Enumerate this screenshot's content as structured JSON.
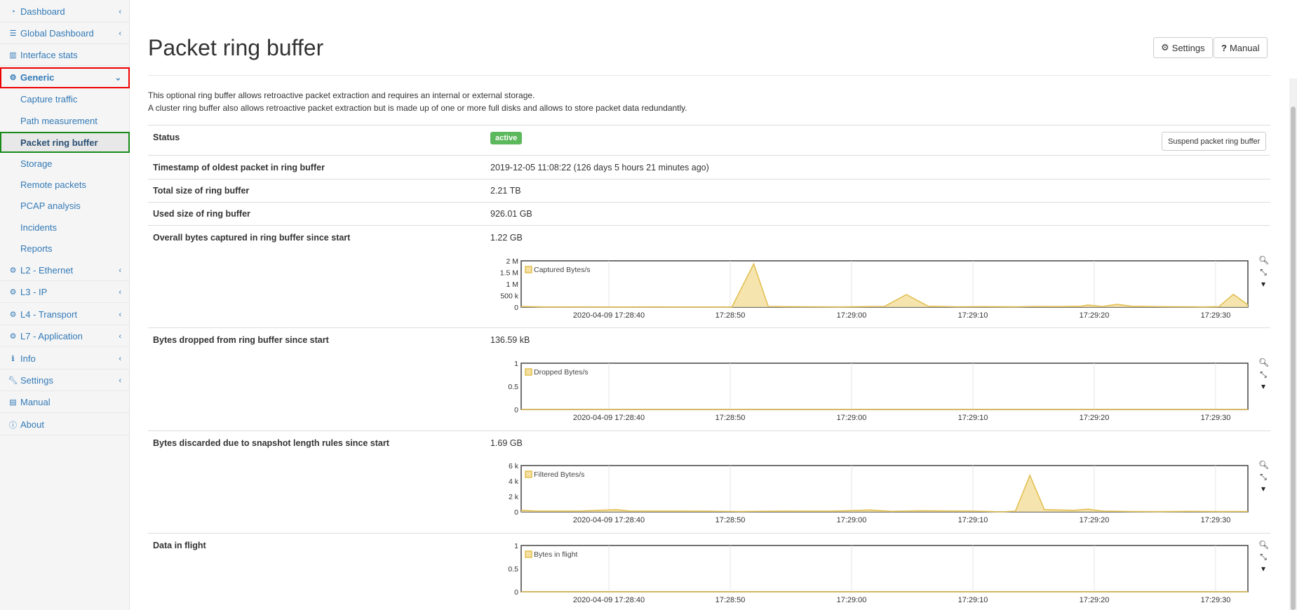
{
  "sidebar": {
    "items": [
      {
        "label": "Dashboard",
        "icon": "dashboard-icon"
      },
      {
        "label": "Global Dashboard",
        "icon": "list-icon"
      },
      {
        "label": "Interface stats",
        "icon": "bar-chart-icon"
      },
      {
        "label": "Generic",
        "icon": "gear-icon"
      },
      {
        "label": "L2 - Ethernet",
        "icon": "gear-icon"
      },
      {
        "label": "L3 - IP",
        "icon": "gear-icon"
      },
      {
        "label": "L4 - Transport",
        "icon": "gear-icon"
      },
      {
        "label": "L7 - Application",
        "icon": "gear-icon"
      },
      {
        "label": "Info",
        "icon": "info-icon"
      },
      {
        "label": "Settings",
        "icon": "wrench-icon"
      },
      {
        "label": "Manual",
        "icon": "book-icon"
      },
      {
        "label": "About",
        "icon": "info-circle-icon"
      }
    ],
    "generic_subitems": [
      "Capture traffic",
      "Path measurement",
      "Packet ring buffer",
      "Storage",
      "Remote packets",
      "PCAP analysis",
      "Incidents",
      "Reports"
    ]
  },
  "header": {
    "title": "Packet ring buffer",
    "settings_label": "Settings",
    "manual_label": "Manual"
  },
  "description": {
    "line1": "This optional ring buffer allows retroactive packet extraction and requires an internal or external storage.",
    "line2": "A cluster ring buffer also allows retroactive packet extraction but is made up of one or more full disks and allows to store packet data redundantly."
  },
  "table": {
    "status_label": "Status",
    "status_value": "active",
    "suspend_label": "Suspend packet ring buffer",
    "oldest_label": "Timestamp of oldest packet in ring buffer",
    "oldest_value": "2019-12-05 11:08:22 (126 days 5 hours 21 minutes ago)",
    "total_label": "Total size of ring buffer",
    "total_value": "2.21 TB",
    "used_label": "Used size of ring buffer",
    "used_value": "926.01 GB",
    "captured_label": "Overall bytes captured in ring buffer since start",
    "captured_value": "1.22 GB",
    "dropped_label": "Bytes dropped from ring buffer since start",
    "dropped_value": "136.59 kB",
    "discarded_label": "Bytes discarded due to snapshot length rules since start",
    "discarded_value": "1.69 GB",
    "inflight_label": "Data in flight"
  },
  "colors": {
    "link": "#337ab7",
    "badge_active": "#5cb85c",
    "series_line": "#e2c053",
    "series_fill": "#f5dfa1",
    "generic_highlight": "#ee0000",
    "current_highlight": "#1a8a1a"
  },
  "chart_data": [
    {
      "type": "area",
      "series": [
        {
          "name": "Captured Bytes/s",
          "values": [
            [
              0,
              30000
            ],
            [
              3,
              10000
            ],
            [
              8,
              8000
            ],
            [
              13,
              5000
            ],
            [
              18,
              9000
            ],
            [
              22,
              6000
            ],
            [
              26,
              3000
            ],
            [
              29,
              2000
            ],
            [
              32,
              1900000
            ],
            [
              34,
              30000
            ],
            [
              36,
              20000
            ],
            [
              40,
              15000
            ],
            [
              44,
              10000
            ],
            [
              48,
              25000
            ],
            [
              50,
              30000
            ],
            [
              53,
              550000
            ],
            [
              56,
              40000
            ],
            [
              60,
              15000
            ],
            [
              64,
              20000
            ],
            [
              68,
              12000
            ],
            [
              71,
              30000
            ],
            [
              74,
              25000
            ],
            [
              77,
              40000
            ],
            [
              78,
              90000
            ],
            [
              80,
              30000
            ],
            [
              82,
              120000
            ],
            [
              84,
              40000
            ],
            [
              88,
              20000
            ],
            [
              92,
              15000
            ],
            [
              94,
              10000
            ],
            [
              96,
              20000
            ],
            [
              98,
              560000
            ],
            [
              100,
              100000
            ]
          ]
        }
      ],
      "x_ticks": [
        "2020-04-09 17:28:40",
        "17:28:50",
        "17:29:00",
        "17:29:10",
        "17:29:20",
        "17:29:30"
      ],
      "y_ticks": [
        "2 M",
        "1.5 M",
        "1 M",
        "500 k",
        "0"
      ],
      "ylim": [
        0,
        2000000
      ]
    },
    {
      "type": "area",
      "series": [
        {
          "name": "Dropped Bytes/s",
          "values": [
            [
              0,
              0
            ],
            [
              100,
              0
            ]
          ]
        }
      ],
      "x_ticks": [
        "2020-04-09 17:28:40",
        "17:28:50",
        "17:29:00",
        "17:29:10",
        "17:29:20",
        "17:29:30"
      ],
      "y_ticks": [
        "1",
        "0.5",
        "0"
      ],
      "ylim": [
        0,
        1
      ]
    },
    {
      "type": "area",
      "series": [
        {
          "name": "Filtered Bytes/s",
          "values": [
            [
              0,
              200
            ],
            [
              2,
              100
            ],
            [
              8,
              100
            ],
            [
              13,
              300
            ],
            [
              15,
              100
            ],
            [
              22,
              100
            ],
            [
              26,
              80
            ],
            [
              30,
              50
            ],
            [
              36,
              100
            ],
            [
              42,
              80
            ],
            [
              45,
              150
            ],
            [
              48,
              250
            ],
            [
              51,
              60
            ],
            [
              55,
              150
            ],
            [
              58,
              120
            ],
            [
              62,
              100
            ],
            [
              64,
              60
            ],
            [
              66,
              0
            ],
            [
              68,
              90
            ],
            [
              70,
              4800
            ],
            [
              72,
              300
            ],
            [
              74,
              250
            ],
            [
              76,
              200
            ],
            [
              78,
              350
            ],
            [
              80,
              100
            ],
            [
              84,
              50
            ],
            [
              88,
              30
            ],
            [
              92,
              60
            ],
            [
              96,
              40
            ],
            [
              100,
              50
            ]
          ]
        }
      ],
      "x_ticks": [
        "2020-04-09 17:28:40",
        "17:28:50",
        "17:29:00",
        "17:29:10",
        "17:29:20",
        "17:29:30"
      ],
      "y_ticks": [
        "6 k",
        "4 k",
        "2 k",
        "0"
      ],
      "ylim": [
        0,
        6000
      ]
    },
    {
      "type": "area",
      "series": [
        {
          "name": "Bytes in flight",
          "values": [
            [
              0,
              0
            ],
            [
              100,
              0
            ]
          ]
        }
      ],
      "x_ticks": [
        "2020-04-09 17:28:40",
        "17:28:50",
        "17:29:00",
        "17:29:10",
        "17:29:20",
        "17:29:30"
      ],
      "y_ticks": [
        "1",
        "0.5",
        "0"
      ],
      "ylim": [
        0,
        1
      ]
    }
  ]
}
